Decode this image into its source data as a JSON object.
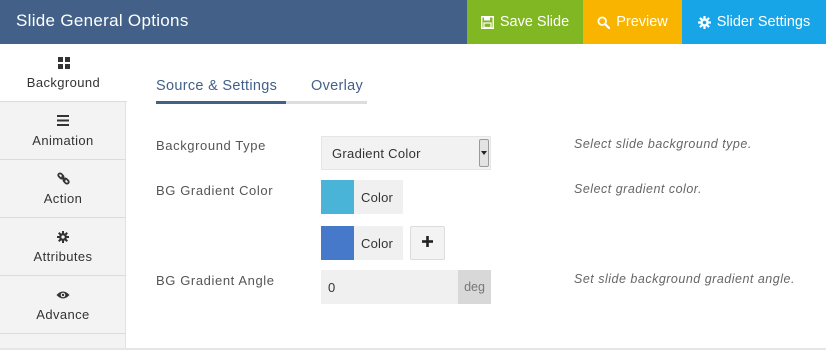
{
  "header": {
    "title": "Slide General Options",
    "buttons": {
      "save": "Save Slide",
      "preview": "Preview",
      "settings": "Slider Settings"
    }
  },
  "sidebar": {
    "items": [
      {
        "label": "Background",
        "icon": "grid-icon",
        "active": true
      },
      {
        "label": "Animation",
        "icon": "list-icon",
        "active": false
      },
      {
        "label": "Action",
        "icon": "link-icon",
        "active": false
      },
      {
        "label": "Attributes",
        "icon": "gear-icon",
        "active": false
      },
      {
        "label": "Advance",
        "icon": "eye-icon",
        "active": false
      }
    ]
  },
  "tabs": [
    {
      "label": "Source & Settings",
      "active": true
    },
    {
      "label": "Overlay",
      "active": false
    }
  ],
  "form": {
    "background_type": {
      "label": "Background Type",
      "value": "Gradient Color",
      "hint": "Select slide background type."
    },
    "gradient_color": {
      "label": "BG Gradient Color",
      "hint": "Select gradient color.",
      "colors": [
        {
          "label": "Color",
          "swatch": "#4ab4d8"
        },
        {
          "label": "Color",
          "swatch": "#4679c9"
        }
      ],
      "add_icon": "plus-icon"
    },
    "gradient_angle": {
      "label": "BG Gradient Angle",
      "value": "0",
      "unit": "deg",
      "hint": "Set slide background gradient angle."
    }
  },
  "colors": {
    "header_bg": "#436188",
    "save_bg": "#80b722",
    "preview_bg": "#f9b400",
    "settings_bg": "#18a5e8",
    "accent": "#436188"
  }
}
